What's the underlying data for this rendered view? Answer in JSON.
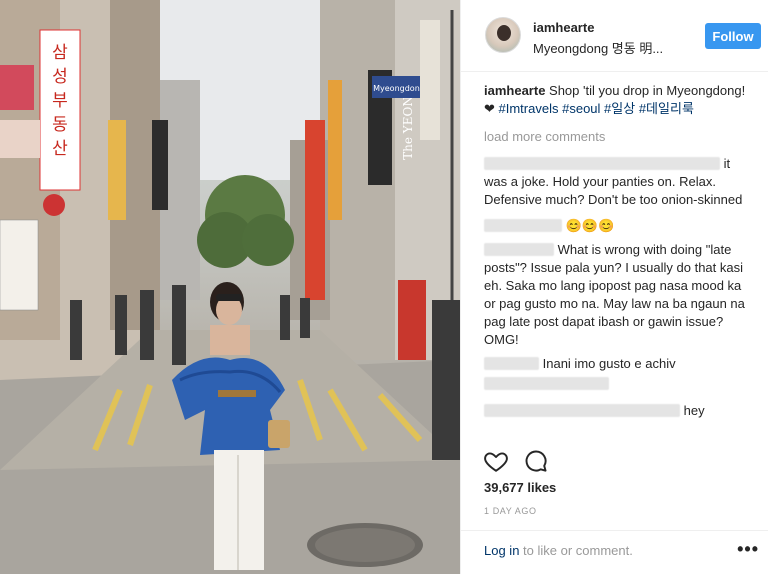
{
  "post": {
    "username": "iamhearte",
    "location": "Myeongdong 명동 明...",
    "follow_label": "Follow",
    "caption": {
      "username": "iamhearte",
      "text_before": " Shop 'til you drop in Myeongdong! ❤ ",
      "tags": [
        "#Imtravels",
        "#seoul",
        "#일상",
        "#데일리룩"
      ]
    },
    "load_more": "load more comments",
    "comments": [
      {
        "text": "it was a joke. Hold your panties on. Relax. Defensive much? Don't be too onion-skinned"
      },
      {
        "text": "😊😊😊"
      },
      {
        "text": "What is wrong with doing \"late posts\"? Issue pala yun? I usually do that kasi eh. Saka mo lang ipopost pag nasa mood ka or pag gusto mo na. May law na ba ngaun na pag late post dapat ibash or gawin issue? OMG!"
      },
      {
        "text": "Inani imo gusto e achiv"
      },
      {
        "text": "hey"
      }
    ],
    "likes": "39,677 likes",
    "timestamp": "1 DAY AGO",
    "footer": {
      "login_link": "Log in",
      "login_rest": " to like or comment.",
      "more": "•••"
    }
  },
  "photo": {
    "signs": [
      "삼성부동산",
      "The YEON",
      "Myeongdong"
    ]
  },
  "icons": {
    "like": "heart-icon",
    "comment": "comment-icon",
    "more": "more-options-icon"
  },
  "colors": {
    "follow_button": "#3897f0",
    "hashtag": "#003569",
    "muted": "#999999"
  }
}
